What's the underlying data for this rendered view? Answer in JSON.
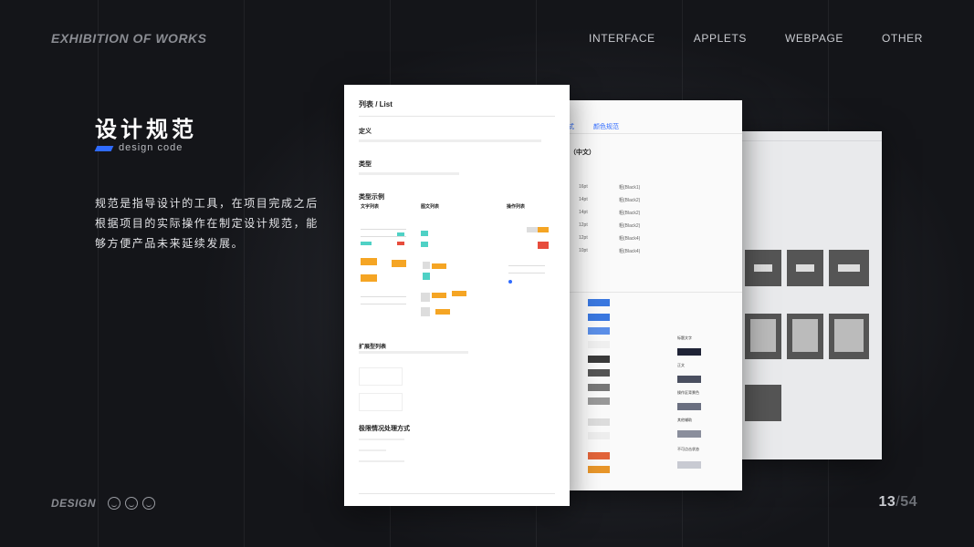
{
  "header": {
    "brand": "EXHIBITION OF WORKS",
    "nav": [
      "INTERFACE",
      "APPLETS",
      "WEBPAGE",
      "OTHER"
    ]
  },
  "hero": {
    "title": "设计规范",
    "subtitle": "design code",
    "description": "规范是指导设计的工具，在项目完成之后根据项目的实际操作在制定设计规范，能够方便产品未来延续发展。"
  },
  "footer": {
    "label": "DESIGN",
    "page_current": "13",
    "page_separator": "/",
    "page_total": "54"
  },
  "colors": {
    "accent": "#2f6bff",
    "orange": "#f5a524",
    "teal": "#4fd1c5",
    "red": "#e74c3c"
  },
  "card_list": {
    "title": "列表 / List",
    "h_definition": "定义",
    "h_type": "类型",
    "h_examples": "类型示例",
    "col1": "文字列表",
    "col2": "图文列表",
    "col3": "操作列表",
    "h_extend": "扩展型列表",
    "h_limit": "极限情况处理方式"
  },
  "card_type": {
    "tab1": "式",
    "tab2": "颜色规范",
    "heading": "（中文）",
    "sizes": [
      "16pt",
      "14pt",
      "14pt",
      "12pt",
      "12pt",
      "10pt"
    ],
    "weights": [
      "粗(Black1)",
      "粗(Black2)",
      "粗(Black2)",
      "粗(Black2)",
      "粗(Black4)",
      "粗(Black4)"
    ],
    "color_labels": [
      "标题文字",
      "正文",
      "操作区背景色",
      "其他辅助",
      "不可点击状态"
    ],
    "color_hex": [
      "#1f2336",
      "#4a4f60",
      "#6a6f80",
      "#8a8e9c",
      "#c8cad2"
    ]
  }
}
